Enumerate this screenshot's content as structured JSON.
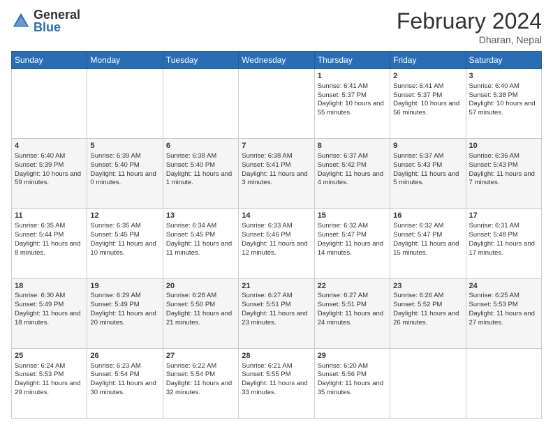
{
  "header": {
    "logo_general": "General",
    "logo_blue": "Blue",
    "month_title": "February 2024",
    "location": "Dharan, Nepal"
  },
  "days_of_week": [
    "Sunday",
    "Monday",
    "Tuesday",
    "Wednesday",
    "Thursday",
    "Friday",
    "Saturday"
  ],
  "weeks": [
    [
      {
        "day": "",
        "info": ""
      },
      {
        "day": "",
        "info": ""
      },
      {
        "day": "",
        "info": ""
      },
      {
        "day": "",
        "info": ""
      },
      {
        "day": "1",
        "info": "Sunrise: 6:41 AM\nSunset: 5:37 PM\nDaylight: 10 hours and 55 minutes."
      },
      {
        "day": "2",
        "info": "Sunrise: 6:41 AM\nSunset: 5:37 PM\nDaylight: 10 hours and 56 minutes."
      },
      {
        "day": "3",
        "info": "Sunrise: 6:40 AM\nSunset: 5:38 PM\nDaylight: 10 hours and 57 minutes."
      }
    ],
    [
      {
        "day": "4",
        "info": "Sunrise: 6:40 AM\nSunset: 5:39 PM\nDaylight: 10 hours and 59 minutes."
      },
      {
        "day": "5",
        "info": "Sunrise: 6:39 AM\nSunset: 5:40 PM\nDaylight: 11 hours and 0 minutes."
      },
      {
        "day": "6",
        "info": "Sunrise: 6:38 AM\nSunset: 5:40 PM\nDaylight: 11 hours and 1 minute."
      },
      {
        "day": "7",
        "info": "Sunrise: 6:38 AM\nSunset: 5:41 PM\nDaylight: 11 hours and 3 minutes."
      },
      {
        "day": "8",
        "info": "Sunrise: 6:37 AM\nSunset: 5:42 PM\nDaylight: 11 hours and 4 minutes."
      },
      {
        "day": "9",
        "info": "Sunrise: 6:37 AM\nSunset: 5:43 PM\nDaylight: 11 hours and 5 minutes."
      },
      {
        "day": "10",
        "info": "Sunrise: 6:36 AM\nSunset: 5:43 PM\nDaylight: 11 hours and 7 minutes."
      }
    ],
    [
      {
        "day": "11",
        "info": "Sunrise: 6:35 AM\nSunset: 5:44 PM\nDaylight: 11 hours and 8 minutes."
      },
      {
        "day": "12",
        "info": "Sunrise: 6:35 AM\nSunset: 5:45 PM\nDaylight: 11 hours and 10 minutes."
      },
      {
        "day": "13",
        "info": "Sunrise: 6:34 AM\nSunset: 5:45 PM\nDaylight: 11 hours and 11 minutes."
      },
      {
        "day": "14",
        "info": "Sunrise: 6:33 AM\nSunset: 5:46 PM\nDaylight: 11 hours and 12 minutes."
      },
      {
        "day": "15",
        "info": "Sunrise: 6:32 AM\nSunset: 5:47 PM\nDaylight: 11 hours and 14 minutes."
      },
      {
        "day": "16",
        "info": "Sunrise: 6:32 AM\nSunset: 5:47 PM\nDaylight: 11 hours and 15 minutes."
      },
      {
        "day": "17",
        "info": "Sunrise: 6:31 AM\nSunset: 5:48 PM\nDaylight: 11 hours and 17 minutes."
      }
    ],
    [
      {
        "day": "18",
        "info": "Sunrise: 6:30 AM\nSunset: 5:49 PM\nDaylight: 11 hours and 18 minutes."
      },
      {
        "day": "19",
        "info": "Sunrise: 6:29 AM\nSunset: 5:49 PM\nDaylight: 11 hours and 20 minutes."
      },
      {
        "day": "20",
        "info": "Sunrise: 6:28 AM\nSunset: 5:50 PM\nDaylight: 11 hours and 21 minutes."
      },
      {
        "day": "21",
        "info": "Sunrise: 6:27 AM\nSunset: 5:51 PM\nDaylight: 11 hours and 23 minutes."
      },
      {
        "day": "22",
        "info": "Sunrise: 6:27 AM\nSunset: 5:51 PM\nDaylight: 11 hours and 24 minutes."
      },
      {
        "day": "23",
        "info": "Sunrise: 6:26 AM\nSunset: 5:52 PM\nDaylight: 11 hours and 26 minutes."
      },
      {
        "day": "24",
        "info": "Sunrise: 6:25 AM\nSunset: 5:53 PM\nDaylight: 11 hours and 27 minutes."
      }
    ],
    [
      {
        "day": "25",
        "info": "Sunrise: 6:24 AM\nSunset: 5:53 PM\nDaylight: 11 hours and 29 minutes."
      },
      {
        "day": "26",
        "info": "Sunrise: 6:23 AM\nSunset: 5:54 PM\nDaylight: 11 hours and 30 minutes."
      },
      {
        "day": "27",
        "info": "Sunrise: 6:22 AM\nSunset: 5:54 PM\nDaylight: 11 hours and 32 minutes."
      },
      {
        "day": "28",
        "info": "Sunrise: 6:21 AM\nSunset: 5:55 PM\nDaylight: 11 hours and 33 minutes."
      },
      {
        "day": "29",
        "info": "Sunrise: 6:20 AM\nSunset: 5:56 PM\nDaylight: 11 hours and 35 minutes."
      },
      {
        "day": "",
        "info": ""
      },
      {
        "day": "",
        "info": ""
      }
    ]
  ]
}
